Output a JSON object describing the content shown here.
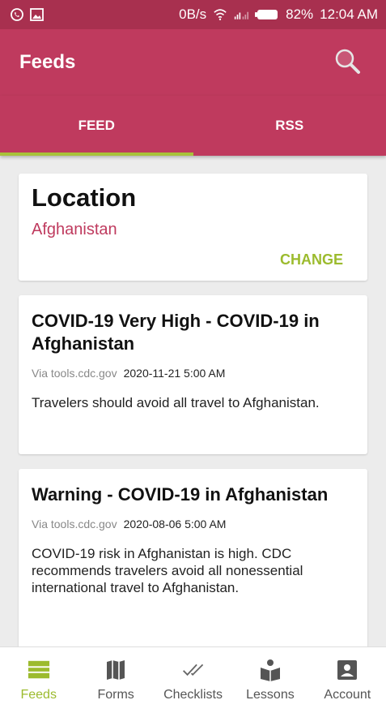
{
  "status_bar": {
    "net_speed": "0B/s",
    "battery": "82%",
    "time": "12:04 AM"
  },
  "app_bar": {
    "title": "Feeds",
    "search_icon": "search-icon"
  },
  "tabs": [
    {
      "label": "FEED",
      "active": true
    },
    {
      "label": "RSS",
      "active": false
    }
  ],
  "location": {
    "title": "Location",
    "value": "Afghanistan",
    "change_label": "CHANGE"
  },
  "feed_items": [
    {
      "title": "COVID-19 Very High - COVID-19 in Afghanistan",
      "via": "Via tools.cdc.gov",
      "date": "2020-11-21 5:00 AM",
      "body": "Travelers should avoid all travel to Afghanistan."
    },
    {
      "title": "Warning - COVID-19 in Afghanistan",
      "via": "Via tools.cdc.gov",
      "date": "2020-08-06 5:00 AM",
      "body": "COVID-19 risk in Afghanistan is high. CDC recommends travelers avoid all nonessential international travel to Afghanistan."
    }
  ],
  "bottom_nav": [
    {
      "label": "Feeds",
      "icon": "list-icon",
      "active": true
    },
    {
      "label": "Forms",
      "icon": "map-icon",
      "active": false
    },
    {
      "label": "Checklists",
      "icon": "double-check-icon",
      "active": false
    },
    {
      "label": "Lessons",
      "icon": "reader-icon",
      "active": false
    },
    {
      "label": "Account",
      "icon": "account-icon",
      "active": false
    }
  ],
  "colors": {
    "primary": "#bf3a5e",
    "status_bar": "#a8304f",
    "accent": "#9cbb2e"
  }
}
